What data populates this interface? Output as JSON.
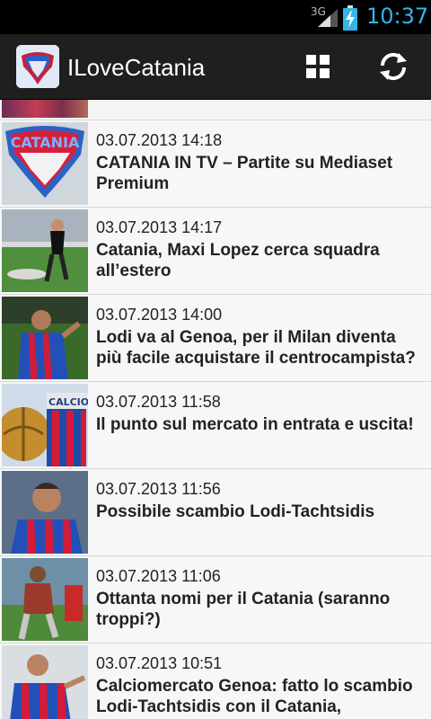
{
  "status_bar": {
    "network": "3G",
    "time": "10:37"
  },
  "action_bar": {
    "title": "ILoveCatania",
    "icons": [
      "app-logo-icon",
      "grid-icon",
      "refresh-icon"
    ]
  },
  "articles": [
    {
      "date": "03.07.2013 14:18",
      "title": "CATANIA IN TV – Partite su Mediaset Premium"
    },
    {
      "date": "03.07.2013 14:17",
      "title": "Catania, Maxi Lopez cerca squadra all’estero"
    },
    {
      "date": "03.07.2013 14:00",
      "title": "Lodi va al Genoa, per il Milan diventa più facile acquistare il centrocampista?"
    },
    {
      "date": "03.07.2013 11:58",
      "title": "Il punto sul mercato in entrata e uscita!"
    },
    {
      "date": "03.07.2013 11:56",
      "title": "Possibile scambio Lodi-Tachtsidis"
    },
    {
      "date": "03.07.2013 11:06",
      "title": "Ottanta nomi per il Catania (saranno troppi?)"
    },
    {
      "date": "03.07.2013 10:51",
      "title": "Calciomercato Genoa: fatto lo scambio Lodi-Tachtsidis con il Catania, sorpassa…"
    }
  ],
  "thumb_labels": {
    "logo_text": "CATANIA",
    "calcio_text": "CALCIO CAT"
  }
}
